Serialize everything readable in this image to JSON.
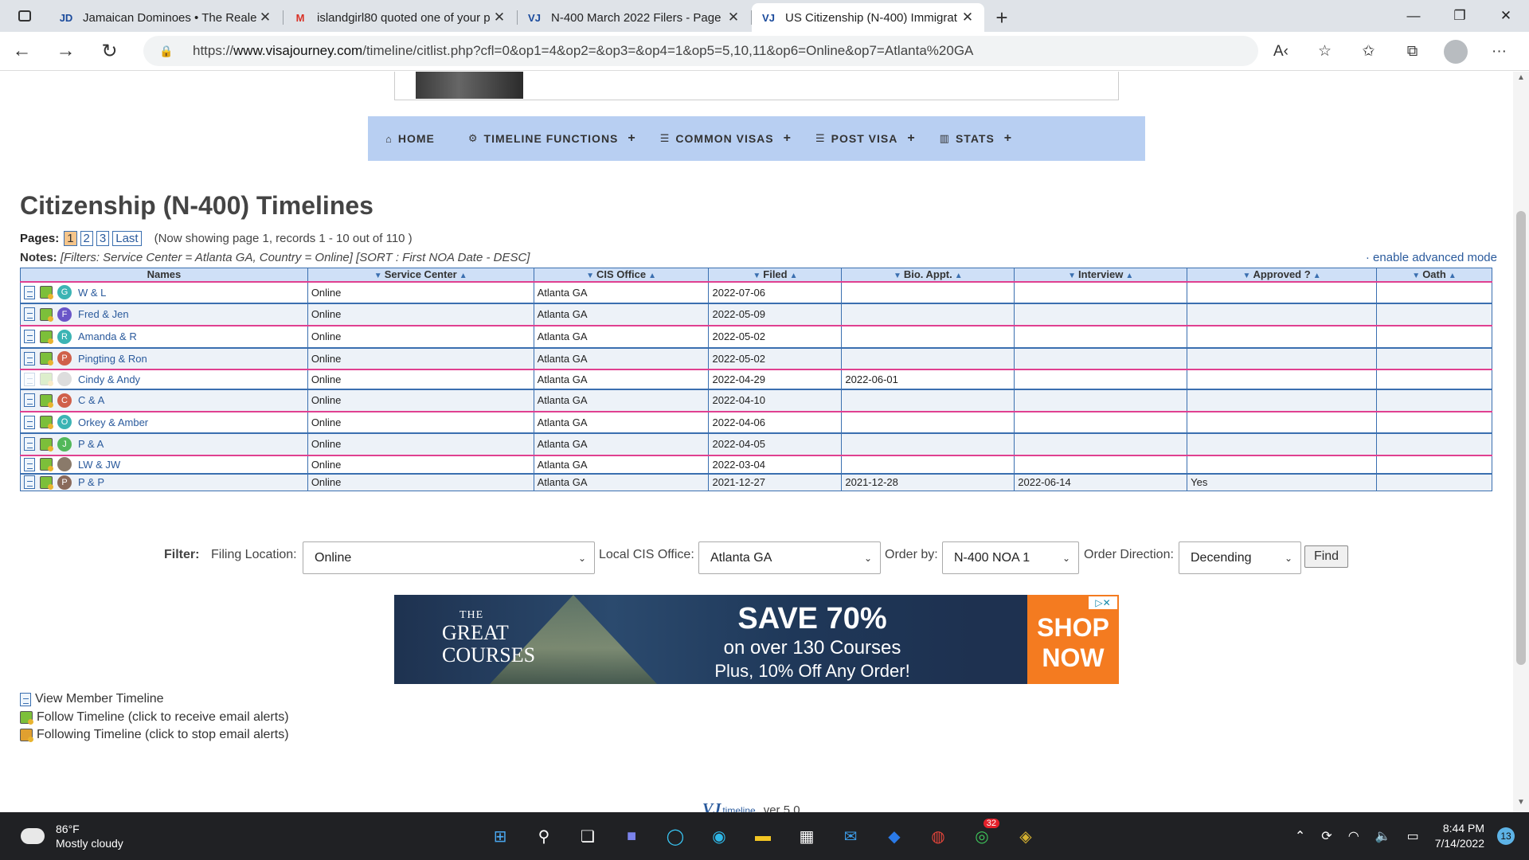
{
  "browser": {
    "tabs": [
      {
        "title": "Jamaican Dominoes • The Realest",
        "favicon": "JD",
        "active": false
      },
      {
        "title": "islandgirl80 quoted one of your p",
        "favicon": "M",
        "active": false
      },
      {
        "title": "N-400 March 2022 Filers - Page",
        "favicon": "VJ",
        "active": false
      },
      {
        "title": "US Citizenship (N-400) Immigrat",
        "favicon": "VJ",
        "active": true
      }
    ],
    "url_prefix": "https://",
    "url_domain": "www.visajourney.com",
    "url_path": "/timeline/citlist.php?cfl=0&op1=4&op2=&op3=&op4=1&op5=5,10,11&op6=Online&op7=Atlanta%20GA"
  },
  "nav": [
    {
      "icon": "home-icon",
      "glyph": "⌂",
      "label": "HOME",
      "plus": ""
    },
    {
      "icon": "gear-icon",
      "glyph": "⚙",
      "label": "TIMELINE FUNCTIONS",
      "plus": "+"
    },
    {
      "icon": "list-icon",
      "glyph": "☰",
      "label": "COMMON VISAS",
      "plus": "+"
    },
    {
      "icon": "list-icon",
      "glyph": "☰",
      "label": "POST VISA",
      "plus": "+"
    },
    {
      "icon": "bar-chart-icon",
      "glyph": "▥",
      "label": "STATS",
      "plus": "+"
    }
  ],
  "page": {
    "title": "Citizenship (N-400) Timelines",
    "pages_label": "Pages:",
    "page_buttons": [
      "1",
      "2",
      "3",
      "Last"
    ],
    "showing": "(Now showing page 1, records 1 - 10 out of 110 )",
    "notes_label": "Notes:",
    "notes_text": "[Filters: Service Center = Atlanta GA, Country = Online] [SORT : First NOA Date - DESC]",
    "advanced_link": "· enable advanced mode"
  },
  "table": {
    "headers": [
      "Names",
      "Service Center",
      "CIS Office",
      "Filed",
      "Bio. Appt.",
      "Interview",
      "Approved ?",
      "Oath"
    ],
    "rows": [
      {
        "name": "W & L",
        "initial": "G",
        "color": "#3cb4b4",
        "sc": "Online",
        "office": "Atlanta GA",
        "filed": "2022-07-06",
        "bio": "",
        "interview": "",
        "approved": "",
        "oath": ""
      },
      {
        "name": "Fred & Jen",
        "initial": "F",
        "color": "#6a56c8",
        "sc": "Online",
        "office": "Atlanta GA",
        "filed": "2022-05-09",
        "bio": "",
        "interview": "",
        "approved": "",
        "oath": ""
      },
      {
        "name": "Amanda & R",
        "initial": "R",
        "color": "#3cb4b4",
        "sc": "Online",
        "office": "Atlanta GA",
        "filed": "2022-05-02",
        "bio": "",
        "interview": "",
        "approved": "",
        "oath": ""
      },
      {
        "name": "Pingting & Ron",
        "initial": "P",
        "color": "#d0604a",
        "sc": "Online",
        "office": "Atlanta GA",
        "filed": "2022-05-02",
        "bio": "",
        "interview": "",
        "approved": "",
        "oath": ""
      },
      {
        "name": "Cindy & Andy",
        "initial": "",
        "color": "#dddddd",
        "sc": "Online",
        "office": "Atlanta GA",
        "filed": "2022-04-29",
        "bio": "2022-06-01",
        "interview": "",
        "approved": "",
        "oath": ""
      },
      {
        "name": "C & A",
        "initial": "C",
        "color": "#d0604a",
        "sc": "Online",
        "office": "Atlanta GA",
        "filed": "2022-04-10",
        "bio": "",
        "interview": "",
        "approved": "",
        "oath": ""
      },
      {
        "name": "Orkey & Amber",
        "initial": "O",
        "color": "#3cb4b4",
        "sc": "Online",
        "office": "Atlanta GA",
        "filed": "2022-04-06",
        "bio": "",
        "interview": "",
        "approved": "",
        "oath": ""
      },
      {
        "name": "P & A",
        "initial": "J",
        "color": "#52b85a",
        "sc": "Online",
        "office": "Atlanta GA",
        "filed": "2022-04-05",
        "bio": "",
        "interview": "",
        "approved": "",
        "oath": ""
      },
      {
        "name": "LW & JW",
        "initial": "",
        "color": "#8a7a6a",
        "sc": "Online",
        "office": "Atlanta GA",
        "filed": "2022-03-04",
        "bio": "",
        "interview": "",
        "approved": "",
        "oath": ""
      },
      {
        "name": "P & P",
        "initial": "P",
        "color": "#8a6a5a",
        "sc": "Online",
        "office": "Atlanta GA",
        "filed": "2021-12-27",
        "bio": "2021-12-28",
        "interview": "2022-06-14",
        "approved": "Yes",
        "oath": ""
      }
    ]
  },
  "filter": {
    "filter_label": "Filter:",
    "filing_location_label": "Filing Location:",
    "filing_location_value": "Online",
    "local_office_label": "Local CIS Office:",
    "local_office_value": "Atlanta GA",
    "order_by_label": "Order by:",
    "order_by_value": "N-400 NOA 1",
    "order_direction_label": "Order Direction:",
    "order_direction_value": "Decending",
    "find_label": "Find"
  },
  "ad": {
    "logo_line1": "THE",
    "logo_line2": "GREAT",
    "logo_line3": "COURSES",
    "headline": "SAVE 70%",
    "line2": "on over 130 Courses",
    "line3": "Plus, 10% Off Any Order!",
    "cta_line1": "SHOP",
    "cta_line2": "NOW"
  },
  "legend": {
    "view": "View Member Timeline",
    "follow": "Follow Timeline (click to receive email alerts)",
    "following": "Following Timeline (click to stop email alerts)"
  },
  "footer": {
    "logo": "VJ",
    "logo_sub": "timeline",
    "version": "ver 5.0"
  },
  "taskbar": {
    "temp": "86°F",
    "condition": "Mostly cloudy",
    "time": "8:44 PM",
    "date": "7/14/2022",
    "notifications": "13",
    "whatsapp_badge": "32"
  }
}
